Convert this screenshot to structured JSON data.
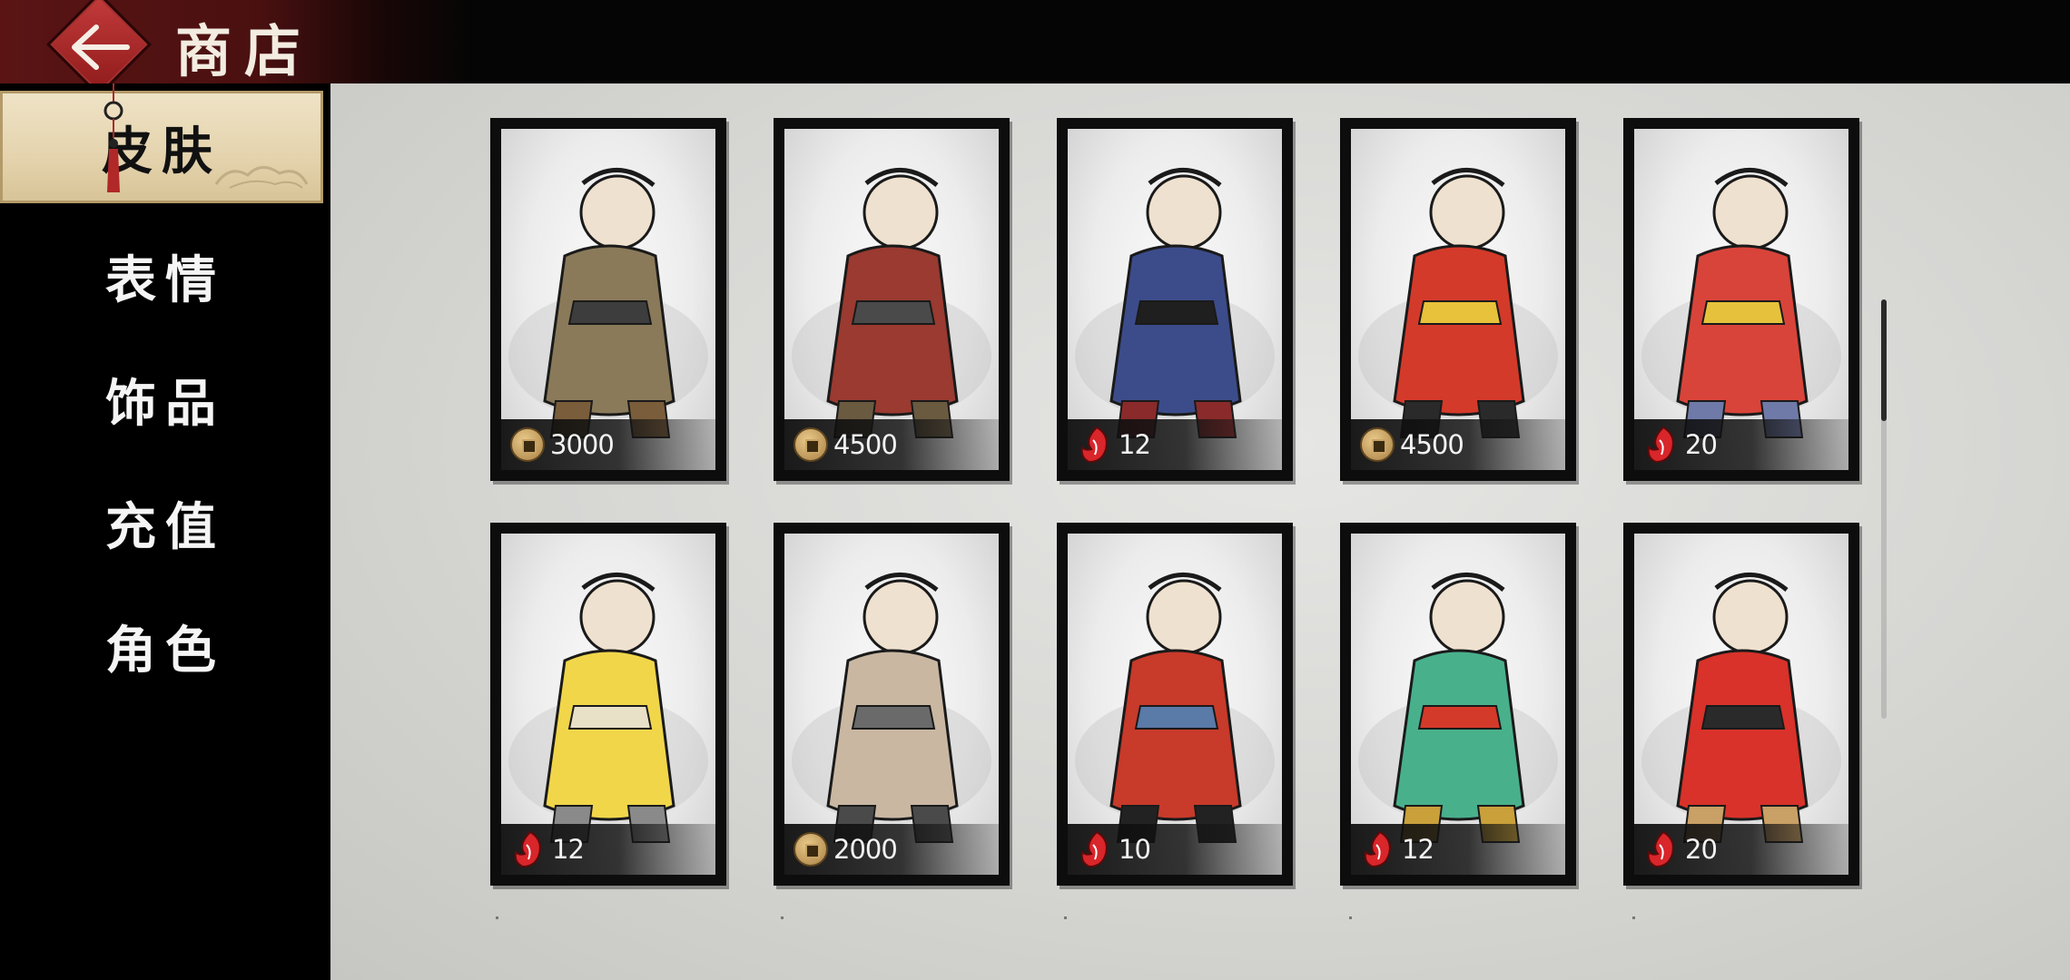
{
  "header": {
    "title": "商店",
    "back_icon": "back-arrow-icon"
  },
  "sidebar": {
    "items": [
      {
        "label": "皮肤",
        "active": true
      },
      {
        "label": "表情",
        "active": false
      },
      {
        "label": "饰品",
        "active": false
      },
      {
        "label": "充值",
        "active": false
      },
      {
        "label": "角色",
        "active": false
      }
    ]
  },
  "colors": {
    "accent_red": "#8e1a1a",
    "active_tab_bg": "#e4d3ad",
    "card_frame": "#0d0d0d",
    "gem_red": "#d8262b",
    "coin_gold": "#c9a465"
  },
  "skins": [
    {
      "currency": "coin",
      "price": "3000"
    },
    {
      "currency": "coin",
      "price": "4500"
    },
    {
      "currency": "gem",
      "price": "12"
    },
    {
      "currency": "coin",
      "price": "4500"
    },
    {
      "currency": "gem",
      "price": "20"
    },
    {
      "currency": "gem",
      "price": "12"
    },
    {
      "currency": "coin",
      "price": "2000"
    },
    {
      "currency": "gem",
      "price": "10"
    },
    {
      "currency": "gem",
      "price": "12"
    },
    {
      "currency": "gem",
      "price": "20"
    }
  ]
}
